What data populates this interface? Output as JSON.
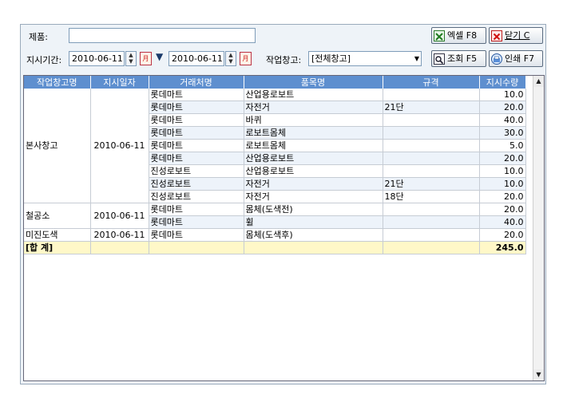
{
  "filters": {
    "product_label": "제품:",
    "product_value": "",
    "period_label": "지시기간:",
    "date_from": "2010-06-11",
    "date_to": "2010-06-11",
    "calendar_glyph": "月",
    "warehouse_label": "작업창고:",
    "warehouse_value": "[전체창고]"
  },
  "buttons": {
    "excel": "엑셀 F8",
    "close": "닫기 C",
    "search": "조회 F5",
    "print": "인쇄 F7"
  },
  "grid": {
    "columns": [
      "작업창고명",
      "지시일자",
      "거래처명",
      "품목명",
      "규격",
      "지시수량"
    ],
    "groups": [
      {
        "warehouse": "본사창고",
        "date": "2010-06-11",
        "rows": [
          {
            "client": "롯데마트",
            "item": "산업용로보트",
            "spec": "",
            "qty": "10.0"
          },
          {
            "client": "롯데마트",
            "item": "자전거",
            "spec": "21단",
            "qty": "20.0"
          },
          {
            "client": "롯데마트",
            "item": "바퀴",
            "spec": "",
            "qty": "40.0"
          },
          {
            "client": "롯데마트",
            "item": "로보트몸체",
            "spec": "",
            "qty": "30.0"
          },
          {
            "client": "롯데마트",
            "item": "로보트몸체",
            "spec": "",
            "qty": "5.0"
          },
          {
            "client": "롯데마트",
            "item": "산업용로보트",
            "spec": "",
            "qty": "20.0"
          },
          {
            "client": "진성로보트",
            "item": "산업용로보트",
            "spec": "",
            "qty": "10.0"
          },
          {
            "client": "진성로보트",
            "item": "자전거",
            "spec": "21단",
            "qty": "10.0"
          },
          {
            "client": "진성로보트",
            "item": "자전거",
            "spec": "18단",
            "qty": "20.0"
          }
        ]
      },
      {
        "warehouse": "철공소",
        "date": "2010-06-11",
        "rows": [
          {
            "client": "롯데마트",
            "item": "몸체(도색전)",
            "spec": "",
            "qty": "20.0"
          },
          {
            "client": "롯데마트",
            "item": "휠",
            "spec": "",
            "qty": "40.0"
          }
        ]
      },
      {
        "warehouse": "미진도색",
        "date": "2010-06-11",
        "rows": [
          {
            "client": "롯데마트",
            "item": "몸체(도색후)",
            "spec": "",
            "qty": "20.0"
          }
        ]
      }
    ],
    "total_label": "[합 계]",
    "total_qty": "245.0"
  },
  "colors": {
    "header_bg": "#5e8fcf",
    "total_bg": "#fff8c8",
    "panel_bg": "#eef3f8"
  }
}
